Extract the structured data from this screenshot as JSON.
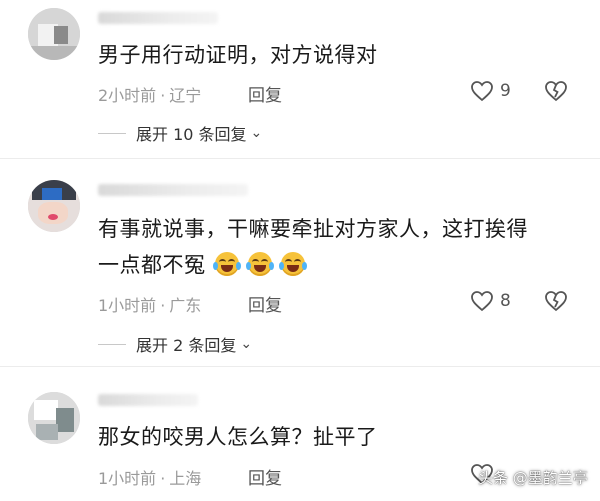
{
  "comments": [
    {
      "text": "男子用行动证明，对方说得对",
      "time": "2小时前",
      "location": "辽宁",
      "reply_label": "回复",
      "likes": "9",
      "expand_label": "展开 10 条回复"
    },
    {
      "text_line1": "有事就说事，干嘛要牵扯对方家人，这打挨得",
      "text_line2": "一点都不冤",
      "emoji_icon": "laughing-crying-emoji",
      "time": "1小时前",
      "location": "广东",
      "reply_label": "回复",
      "likes": "8",
      "expand_label": "展开 2 条回复"
    },
    {
      "text": "那女的咬男人怎么算？扯平了",
      "time": "1小时前",
      "location": "上海",
      "reply_label": "回复"
    }
  ],
  "separator": "·",
  "watermark": "头条 @墨韵兰亭",
  "colors": {
    "text": "#1a1a1a",
    "meta": "#9a9a9a",
    "divider": "#ececec"
  }
}
